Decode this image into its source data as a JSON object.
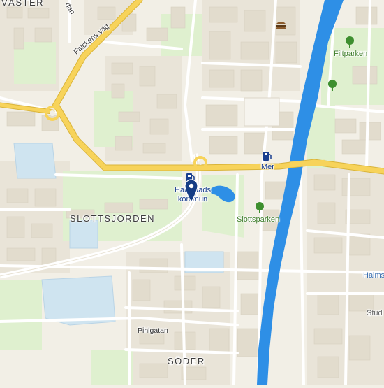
{
  "colors": {
    "background": "#f2efe6",
    "park": "#d9ecc5",
    "green_area": "#e3efd5",
    "water": "#2e8fe6",
    "major_road": "#f7d35a",
    "road": "#ffffff",
    "building": "#e4dfd3",
    "institution": "#cfe4f0",
    "marker": "#163d85"
  },
  "labels": {
    "vaster": "VÄSTER",
    "slottsjorden": "SLOTTSJORDEN",
    "soder": "SÖDER",
    "falckens_vag": "Falckens väg",
    "dan": "dan",
    "pihlgatan": "Pihlgatan",
    "filtparken": "Filtparken",
    "slottsparken": "Slottsparken",
    "mer": "Mer",
    "halmstads_kommun": "Halmstads kommun",
    "halms": "Halms",
    "stud": "Stud"
  },
  "icons": [
    "map-pin-icon",
    "fuel-station-icon",
    "tree-icon",
    "burger-icon"
  ]
}
